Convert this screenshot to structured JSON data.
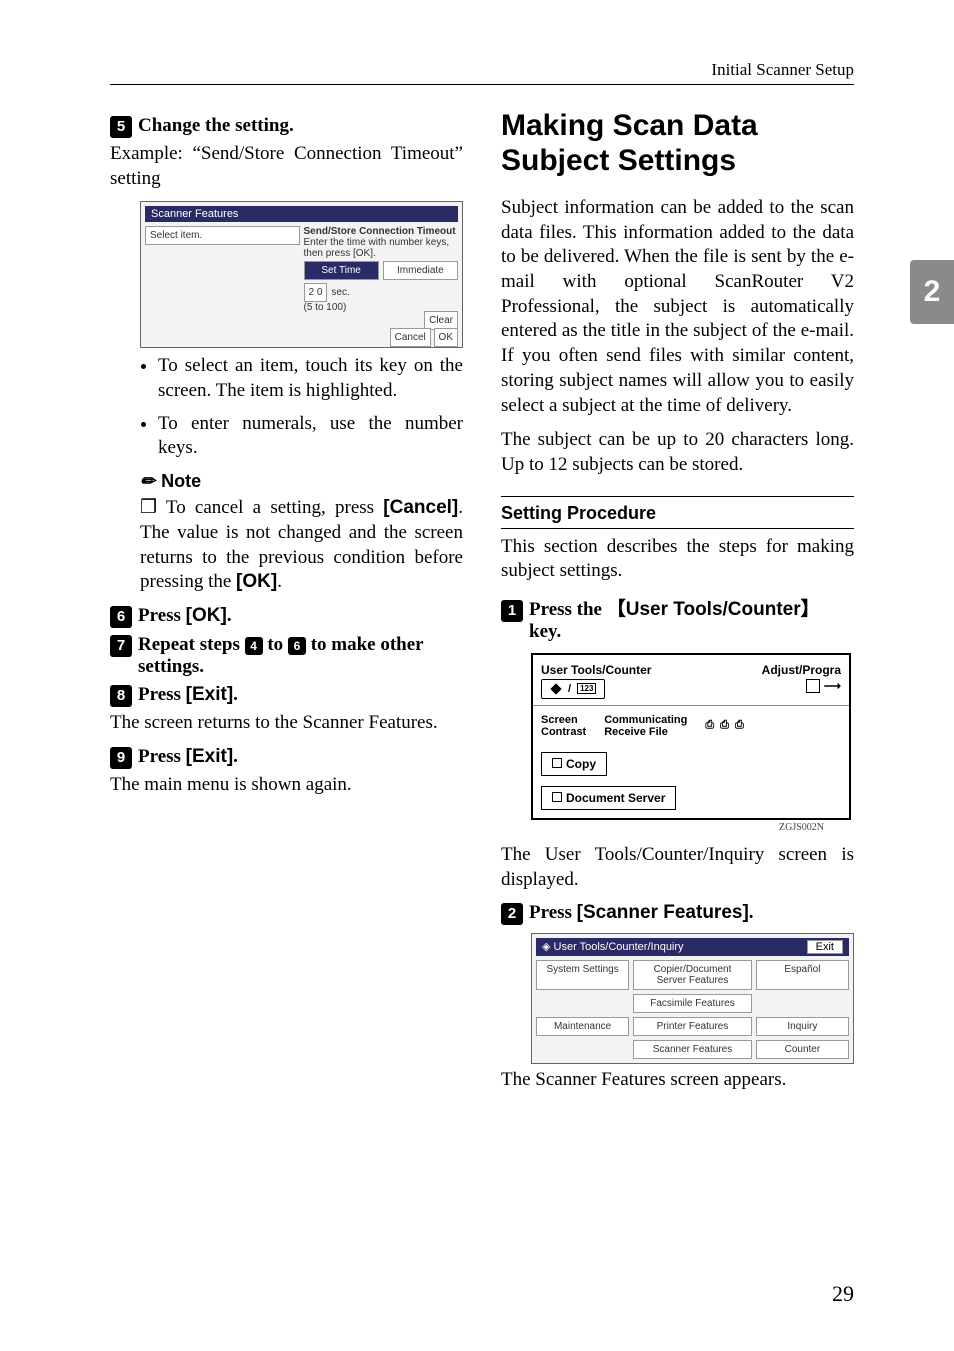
{
  "running_head": "Initial Scanner Setup",
  "side_tab": "2",
  "page_number": "29",
  "left": {
    "step5": {
      "num": "5",
      "text": "Change the setting."
    },
    "example_intro": "Example: “Send/Store Connection Timeout” setting",
    "bullets": [
      "To select an item, touch its key on the screen. The item is highlighted.",
      "To enter numerals, use the number keys."
    ],
    "note_label": "Note",
    "note_body_pre": "To cancel a setting, press ",
    "note_cancel": "[Cancel]",
    "note_body_mid": ". The value is not changed and the screen returns to the previous condition before pressing the ",
    "note_ok": "[OK]",
    "note_body_post": ".",
    "step6": {
      "num": "6",
      "text_pre": "Press ",
      "key": "[OK]",
      "text_post": "."
    },
    "step7": {
      "num": "7",
      "text_pre": "Repeat steps ",
      "ref_a": "4",
      "mid": " to ",
      "ref_b": "6",
      "text_post": " to make other settings."
    },
    "step8": {
      "num": "8",
      "text_pre": "Press ",
      "key": "[Exit]",
      "text_post": "."
    },
    "after8": "The screen returns to the Scanner Features.",
    "step9": {
      "num": "9",
      "text_pre": "Press ",
      "key": "[Exit]",
      "text_post": "."
    },
    "after9": "The main menu is shown again.",
    "screenshot_labels": {
      "panel_title": "Scanner Features",
      "dialog_title": "Send/Store Connection Timeout",
      "dialog_hint": "Enter the time with number keys, then press [OK].",
      "set_time": "Set Time",
      "immediate": "Immediate",
      "value": "2 0",
      "unit": "sec.",
      "range": "(5 to 100)",
      "clear": "Clear",
      "cancel_btn": "Cancel",
      "ok_btn": "OK"
    }
  },
  "right": {
    "h2": "Making Scan Data Subject Settings",
    "para1": "Subject information can be added to the scan data files. This information added to the data to be delivered. When the file is sent by the e-mail with optional ScanRouter V2 Professional, the subject is automatically entered as the title in the subject of the e-mail. If you often send files with similar content, storing subject names will allow you to easily select a subject at the time of delivery.",
    "para2": "The subject can be up to 20 characters long. Up to 12 subjects can be stored.",
    "sub_heading": "Setting Procedure",
    "sub_intro": "This section describes the steps for making subject settings.",
    "step1": {
      "num": "1",
      "text_pre": "Press the ",
      "key": "【User Tools/Counter】",
      "text_post": " key."
    },
    "panel": {
      "ut_label": "User Tools/Counter",
      "adjust": "Adjust/Progra",
      "screen": "Screen",
      "contrast": "Contrast",
      "commu": "Communicating",
      "receive": "Receive File",
      "copy": "Copy",
      "docserver": "Document Server",
      "caption": "ZGJS002N"
    },
    "after1": "The User Tools/Counter/Inquiry screen is displayed.",
    "step2": {
      "num": "2",
      "text_pre": "Press ",
      "key": "[Scanner Features]",
      "text_post": "."
    },
    "ut_shot": {
      "title": "User Tools/Counter/Inquiry",
      "exit": "Exit",
      "system": "System Settings",
      "copier": "Copier/Document Server Features",
      "espanol": "Español",
      "fax": "Facsimile Features",
      "maint": "Maintenance",
      "printer": "Printer Features",
      "inquiry": "Inquiry",
      "scanner": "Scanner Features",
      "counter": "Counter"
    },
    "after2": "The Scanner Features screen appears."
  }
}
